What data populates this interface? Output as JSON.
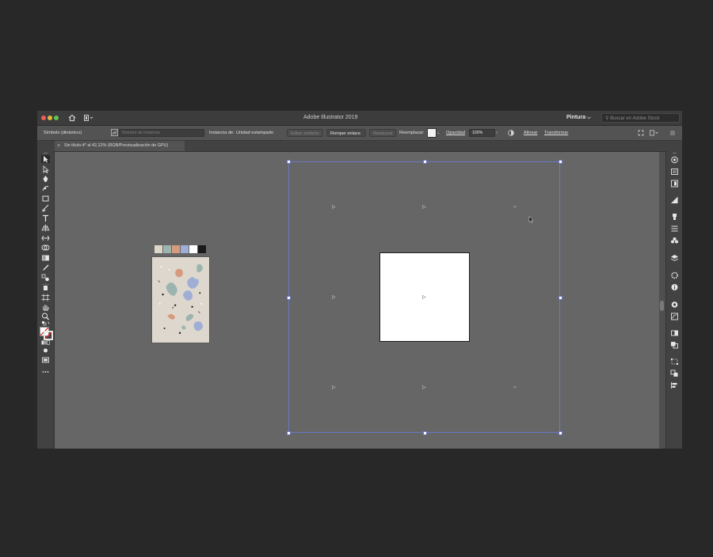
{
  "window": {
    "title": "Adobe Illustrator 2019",
    "workspace": "Pintura",
    "search_placeholder": "Buscar en Adobe Stock"
  },
  "control_bar": {
    "object_type": "Símbolo (dinámico)",
    "instance_name_placeholder": "Nombre de instancia",
    "instance_of_label": "Instancia de:",
    "instance_of_value": "Unidad estampado",
    "edit_symbol": "Editar símbolo",
    "break_link": "Romper enlace",
    "reset": "Restaurar",
    "replace_label": "Reemplazar:",
    "opacity_label": "Opacidad",
    "opacity_value": "100%",
    "align": "Alinear",
    "transform": "Transformar"
  },
  "document_tab": {
    "label": "Sin título-4* al 42,12% (RGB/Previsualización de GPU)"
  },
  "colors": {
    "accent": "#6b78c4",
    "canvas": "#666666",
    "window": "#535353",
    "artboard": "#ffffff",
    "thumbnail_bg": "#ddd7cd"
  },
  "palette_swatches": [
    "#dcd6cb",
    "#9cb4ad",
    "#d69a7c",
    "#a0aed6",
    "#ffffff",
    "#1a1a1a"
  ],
  "tools": [
    "selection-tool",
    "direct-selection-tool",
    "pen-tool",
    "curvature-tool",
    "rectangle-tool",
    "paintbrush-tool",
    "pencil-tool",
    "type-tool",
    "width-tool",
    "free-transform-tool",
    "shape-builder-tool",
    "gradient-tool",
    "eyedropper-tool",
    "blend-tool",
    "symbol-sprayer-tool",
    "artboard-tool",
    "hand-tool",
    "zoom-tool",
    "fill-stroke",
    "draw-mode",
    "screen-mode",
    "more-tools"
  ],
  "panels": [
    "color-guide",
    "properties",
    "libraries",
    "color",
    "brushes",
    "stroke",
    "symbols",
    "layers",
    "appearance",
    "info",
    "graphic-styles",
    "image-trace",
    "transparency",
    "pathfinder",
    "transform",
    "artboards",
    "align"
  ]
}
